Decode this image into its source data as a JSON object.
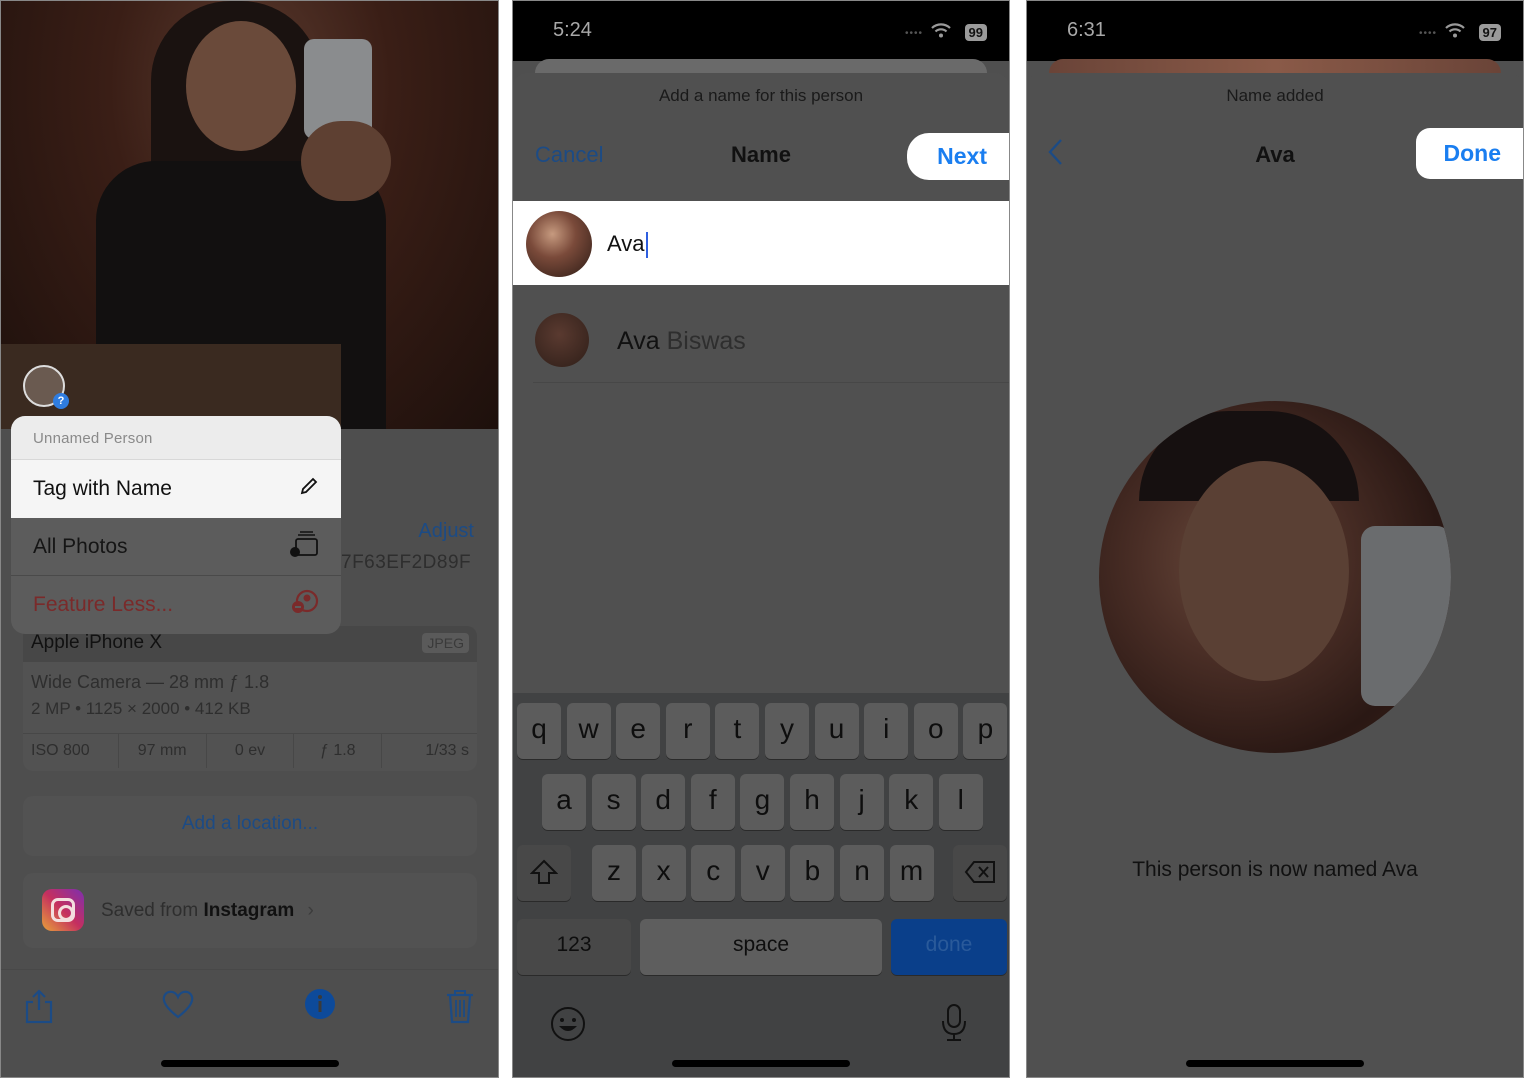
{
  "panel1": {
    "context_menu": {
      "header": "Unnamed Person",
      "items": [
        {
          "label": "Tag with Name",
          "icon": "pencil-icon",
          "highlighted": true
        },
        {
          "label": "All Photos",
          "icon": "photo-stack-person-icon"
        },
        {
          "label": "Feature Less...",
          "icon": "person-minus-icon",
          "destructive": true
        }
      ]
    },
    "face_badge": "?",
    "adjust_label": "Adjust",
    "photo_id_fragment": "7F63EF2D89F",
    "device": "Apple iPhone X",
    "format_badge": "JPEG",
    "lens": "Wide Camera — 28 mm ƒ 1.8",
    "specs": "2 MP  •  1125 × 2000  •  412 KB",
    "exif": [
      "ISO 800",
      "97 mm",
      "0 ev",
      "ƒ 1.8",
      "1/33 s"
    ],
    "add_location": "Add a location...",
    "source_prefix": "Saved from",
    "source_app": "Instagram",
    "source_chevron": "›",
    "toolbar": [
      "share-icon",
      "heart-icon",
      "info-icon",
      "trash-icon"
    ]
  },
  "panel2": {
    "status": {
      "time": "5:24",
      "battery": "99"
    },
    "subtitle": "Add a name for this person",
    "nav": {
      "left": "Cancel",
      "title": "Name",
      "right": "Next"
    },
    "name_input_value": "Ava",
    "suggestion": {
      "match": "Ava",
      "rest": " Biswas"
    },
    "keyboard": {
      "row1": [
        "q",
        "w",
        "e",
        "r",
        "t",
        "y",
        "u",
        "i",
        "o",
        "p"
      ],
      "row2": [
        "a",
        "s",
        "d",
        "f",
        "g",
        "h",
        "j",
        "k",
        "l"
      ],
      "row3": [
        "z",
        "x",
        "c",
        "v",
        "b",
        "n",
        "m"
      ],
      "numbers": "123",
      "space": "space",
      "return": "done"
    }
  },
  "panel3": {
    "status": {
      "time": "6:31",
      "battery": "97"
    },
    "subtitle": "Name added",
    "nav": {
      "title": "Ava",
      "right": "Done"
    },
    "confirmation": "This person is now named Ava"
  },
  "colors": {
    "accent_blue": "#1a7ef0",
    "link_dimmed": "#1c4b85",
    "destructive_dimmed": "#7a2a2a",
    "keyboard_done": "#0a3f8a"
  }
}
